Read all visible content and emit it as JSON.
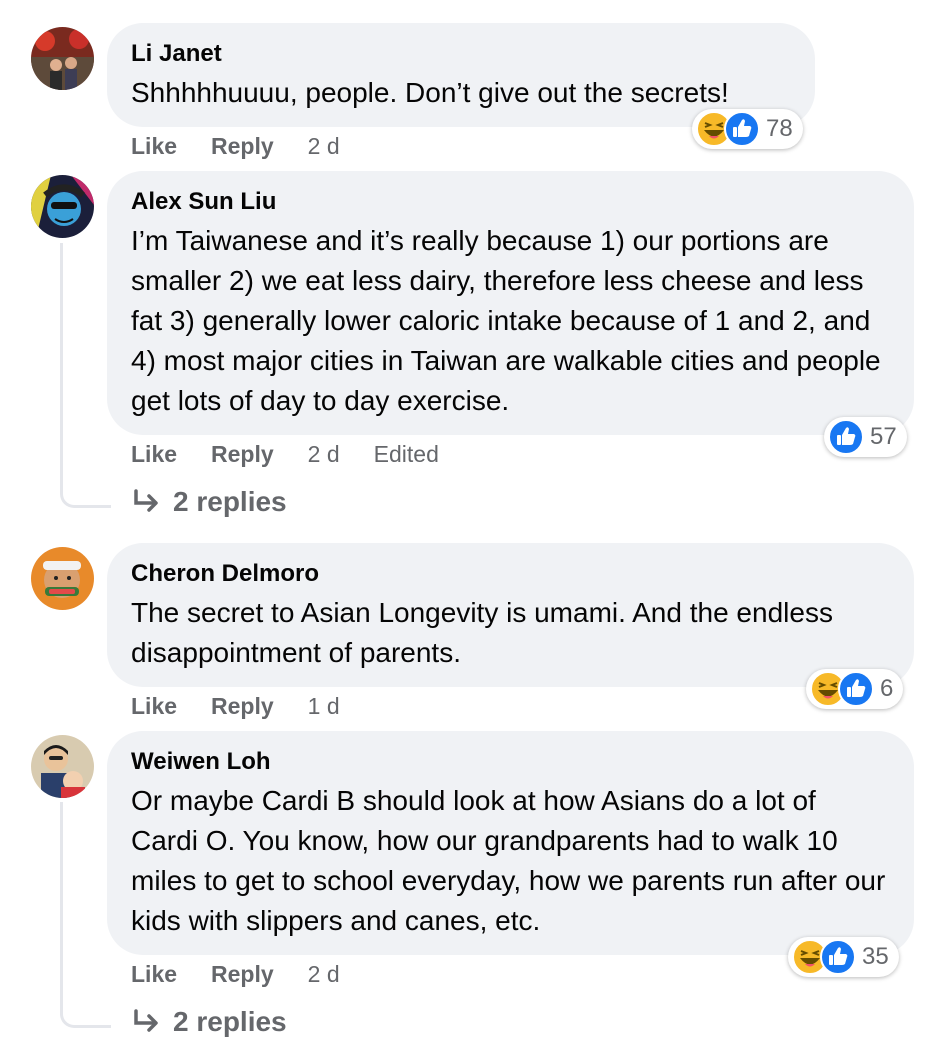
{
  "comments": [
    {
      "author": "Li Janet",
      "text": "Shhhhhuuuu, people. Don’t give out the secrets!",
      "like": "Like",
      "reply": "Reply",
      "time": "2 d",
      "reactions": [
        "laugh",
        "like"
      ],
      "reaction_count": "78"
    },
    {
      "author": "Alex Sun Liu",
      "text": "I’m Taiwanese and it’s really because 1) our portions are smaller 2) we eat less dairy, therefore less cheese and less fat 3) generally lower caloric intake because of 1 and 2, and 4) most major cities in Taiwan are walkable cities and people get lots of day to day exercise.",
      "like": "Like",
      "reply": "Reply",
      "time": "2 d",
      "edited": "Edited",
      "reactions": [
        "like"
      ],
      "reaction_count": "57",
      "replies": "2 replies"
    },
    {
      "author": "Cheron Delmoro",
      "text": "The secret to Asian Longevity is umami. And the endless disappointment of parents.",
      "like": "Like",
      "reply": "Reply",
      "time": "1 d",
      "reactions": [
        "laugh",
        "like"
      ],
      "reaction_count": "6"
    },
    {
      "author": "Weiwen Loh",
      "text": "Or maybe Cardi B should look at how Asians do a lot of Cardi O. You know, how our grandparents had to walk 10 miles to get to school everyday, how we parents run after our kids with slippers and canes, etc.",
      "like": "Like",
      "reply": "Reply",
      "time": "2 d",
      "reactions": [
        "laugh",
        "like"
      ],
      "reaction_count": "35",
      "replies": "2 replies"
    }
  ],
  "colors": {
    "bubble": "#f0f2f5",
    "secondary_text": "#65676b",
    "like_blue": "#1877f2",
    "haha_yellow": "#f7b928"
  }
}
